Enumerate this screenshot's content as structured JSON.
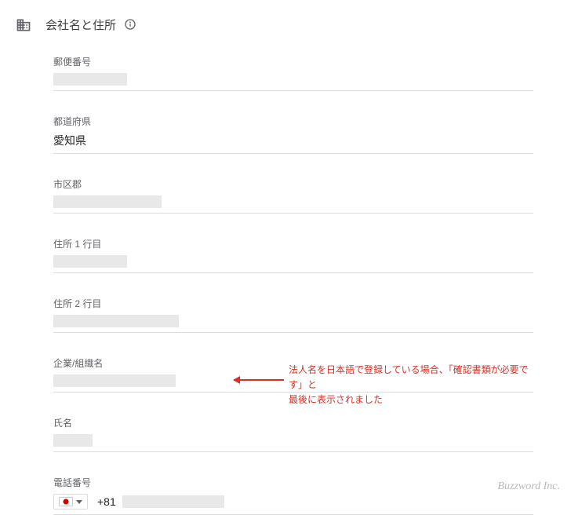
{
  "header": {
    "title": "会社名と住所"
  },
  "fields": {
    "postal": {
      "label": "郵便番号",
      "value": ""
    },
    "prefecture": {
      "label": "都道府県",
      "value": "愛知県"
    },
    "city": {
      "label": "市区郡",
      "value": ""
    },
    "addr1": {
      "label": "住所 1 行目",
      "value": ""
    },
    "addr2": {
      "label": "住所 2 行目",
      "value": ""
    },
    "org": {
      "label": "企業/組織名",
      "value": ""
    },
    "name": {
      "label": "氏名",
      "value": ""
    },
    "phone": {
      "label": "電話番号",
      "dialcode": "+81",
      "value": ""
    }
  },
  "annotation": {
    "line1": "法人名を日本語で登録している場合、「確認書類が必要です」と",
    "line2": "最後に表示されました"
  },
  "credit": "Buzzword Inc."
}
